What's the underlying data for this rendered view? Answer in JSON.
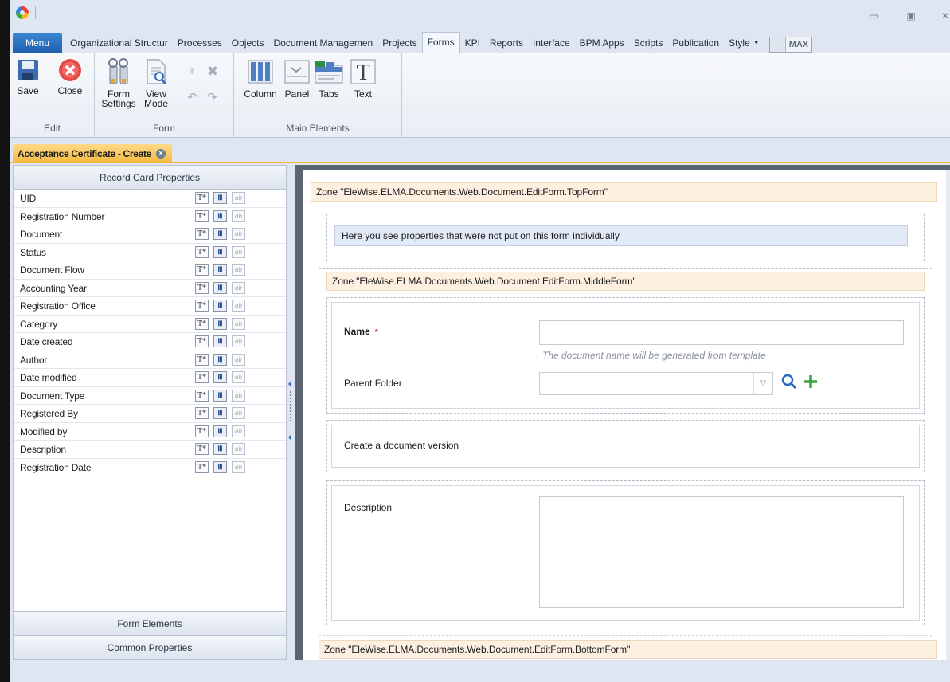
{
  "ribbon_tabs": [
    "Menu",
    "Organizational Structur",
    "Processes",
    "Objects",
    "Document Managemen",
    "Projects",
    "Forms",
    "KPI",
    "Reports",
    "Interface",
    "BPM Apps",
    "Scripts",
    "Publication",
    "Style"
  ],
  "active_tab": "Forms",
  "max_label": "MAX",
  "ribbon": {
    "edit": {
      "label": "Edit",
      "save": "Save",
      "close": "Close"
    },
    "form": {
      "label": "Form",
      "form_settings_1": "Form",
      "form_settings_2": "Settings",
      "view_mode_1": "View",
      "view_mode_2": "Mode"
    },
    "main_elements": {
      "label": "Main Elements",
      "column": "Column",
      "panel": "Panel",
      "tabs": "Tabs",
      "text": "Text"
    }
  },
  "doc_tab": "Acceptance Certificate - Create",
  "left_panel": {
    "header": "Record Card Properties",
    "properties": [
      "UID",
      "Registration Number",
      "Document",
      "Status",
      "Document Flow",
      "Accounting Year",
      "Registration Office",
      "Category",
      "Date created",
      "Author",
      "Date modified",
      "Document Type",
      "Registered By",
      "Modified by",
      "Description",
      "Registration Date"
    ],
    "icon_labels": {
      "text": "T*",
      "table": "Ⅲ",
      "ab": "ab"
    },
    "footer_1": "Form Elements",
    "footer_2": "Common Properties"
  },
  "canvas": {
    "zone_top": "Zone \"EleWise.ELMA.Documents.Web.Document.EditForm.TopForm\"",
    "info": "Here you see properties that were not put on this form individually",
    "zone_middle": "Zone \"EleWise.ELMA.Documents.Web.Document.EditForm.MiddleForm\"",
    "name_label": "Name",
    "required_mark": "*",
    "name_hint": "The document name will be generated from template",
    "parent_folder_label": "Parent Folder",
    "create_version": "Create a document version",
    "description_label": "Description",
    "zone_bottom": "Zone \"EleWise.ELMA.Documents.Web.Document.EditForm.BottomForm\""
  },
  "colors": {
    "accent": "#1f5fae",
    "doc_tab": "#f4b93a",
    "zone_bg": "#fdf0e1",
    "info_bg": "#e2e9f7"
  }
}
